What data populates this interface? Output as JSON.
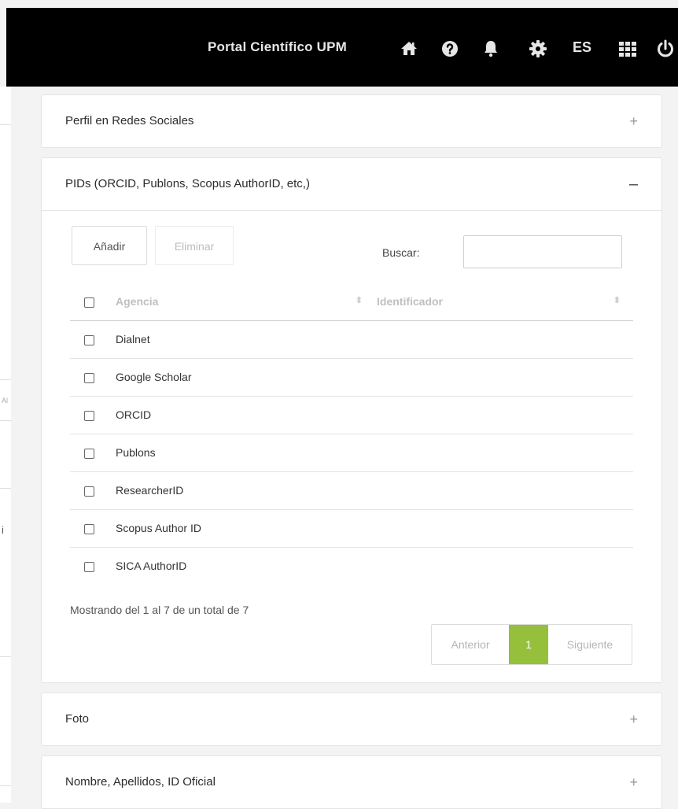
{
  "topbar": {
    "title": "Portal Científico UPM",
    "icons": [
      "home-icon",
      "help-icon",
      "bell-icon",
      "gear-icon",
      "apps-grid-icon",
      "power-icon"
    ],
    "language": "ES",
    "background": "#000000"
  },
  "left_fragments": [
    "Al",
    "i"
  ],
  "panels": [
    {
      "title": "Perfil en Redes Sociales",
      "toggle": "+"
    },
    {
      "title": "PIDs (ORCID, Publons, Scopus AuthorID, etc,)",
      "toggle": "–"
    },
    {
      "title": "Foto",
      "toggle": "+"
    },
    {
      "title": "Nombre, Apellidos, ID Oficial",
      "toggle": "+"
    }
  ],
  "pids": {
    "add_label": "Añadir",
    "delete_label": "Eliminar",
    "search_label": "Buscar:",
    "search_value": "",
    "columns": [
      "Agencia",
      "Identificador"
    ],
    "rows": [
      {
        "agency": "Dialnet",
        "identifier": ""
      },
      {
        "agency": "Google Scholar",
        "identifier": ""
      },
      {
        "agency": "ORCID",
        "identifier": ""
      },
      {
        "agency": "Publons",
        "identifier": ""
      },
      {
        "agency": "ResearcherID",
        "identifier": ""
      },
      {
        "agency": "Scopus Author ID",
        "identifier": ""
      },
      {
        "agency": "SICA AuthorID",
        "identifier": ""
      }
    ],
    "info": "Mostrando del 1 al 7 de un total de 7",
    "pagination": {
      "prev": "Anterior",
      "current": "1",
      "next": "Siguiente"
    }
  },
  "colors": {
    "accent": "#96bf3c"
  }
}
